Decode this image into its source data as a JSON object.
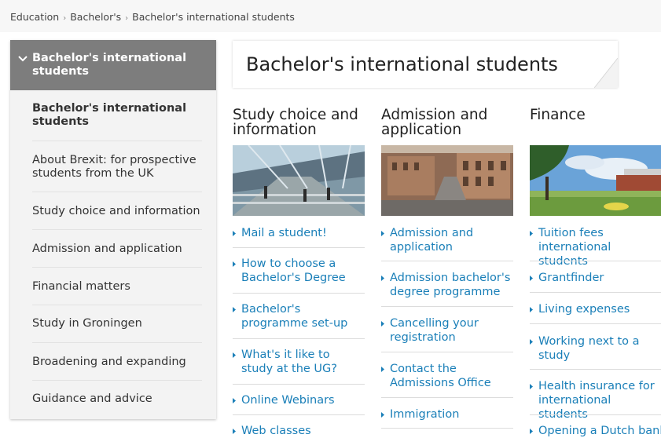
{
  "breadcrumb": {
    "items": [
      "Education",
      "Bachelor's",
      "Bachelor's international students"
    ]
  },
  "sidebar": {
    "header": "Bachelor's international students",
    "items": [
      "Bachelor's international students",
      "About Brexit: for prospective students from the UK",
      "Study choice and information",
      "Admission and application",
      "Financial matters",
      "Study in Groningen",
      "Broadening and expanding",
      "Guidance and advice"
    ]
  },
  "page": {
    "title": "Bachelor's international students"
  },
  "columns": [
    {
      "title": "Study choice and information",
      "links": [
        "Mail a student!",
        "How to choose a Bachelor's Degree",
        "Bachelor's programme set-up",
        "What's it like to study at the UG?",
        "Online Webinars",
        "Web classes"
      ]
    },
    {
      "title": "Admission and application",
      "links": [
        "Admission and application",
        "Admission bachelor's degree programme",
        "Cancelling your registration",
        "Contact the Admissions Office",
        "Immigration"
      ]
    },
    {
      "title": "Finance",
      "links": [
        "Tuition fees international students",
        "Grantfinder",
        "Living expenses",
        "Working next to a study",
        "Health insurance for international students",
        "Opening a Dutch bank"
      ]
    }
  ],
  "colors": {
    "link": "#1a7fb8",
    "sidebar_header": "#7d7d7d"
  }
}
